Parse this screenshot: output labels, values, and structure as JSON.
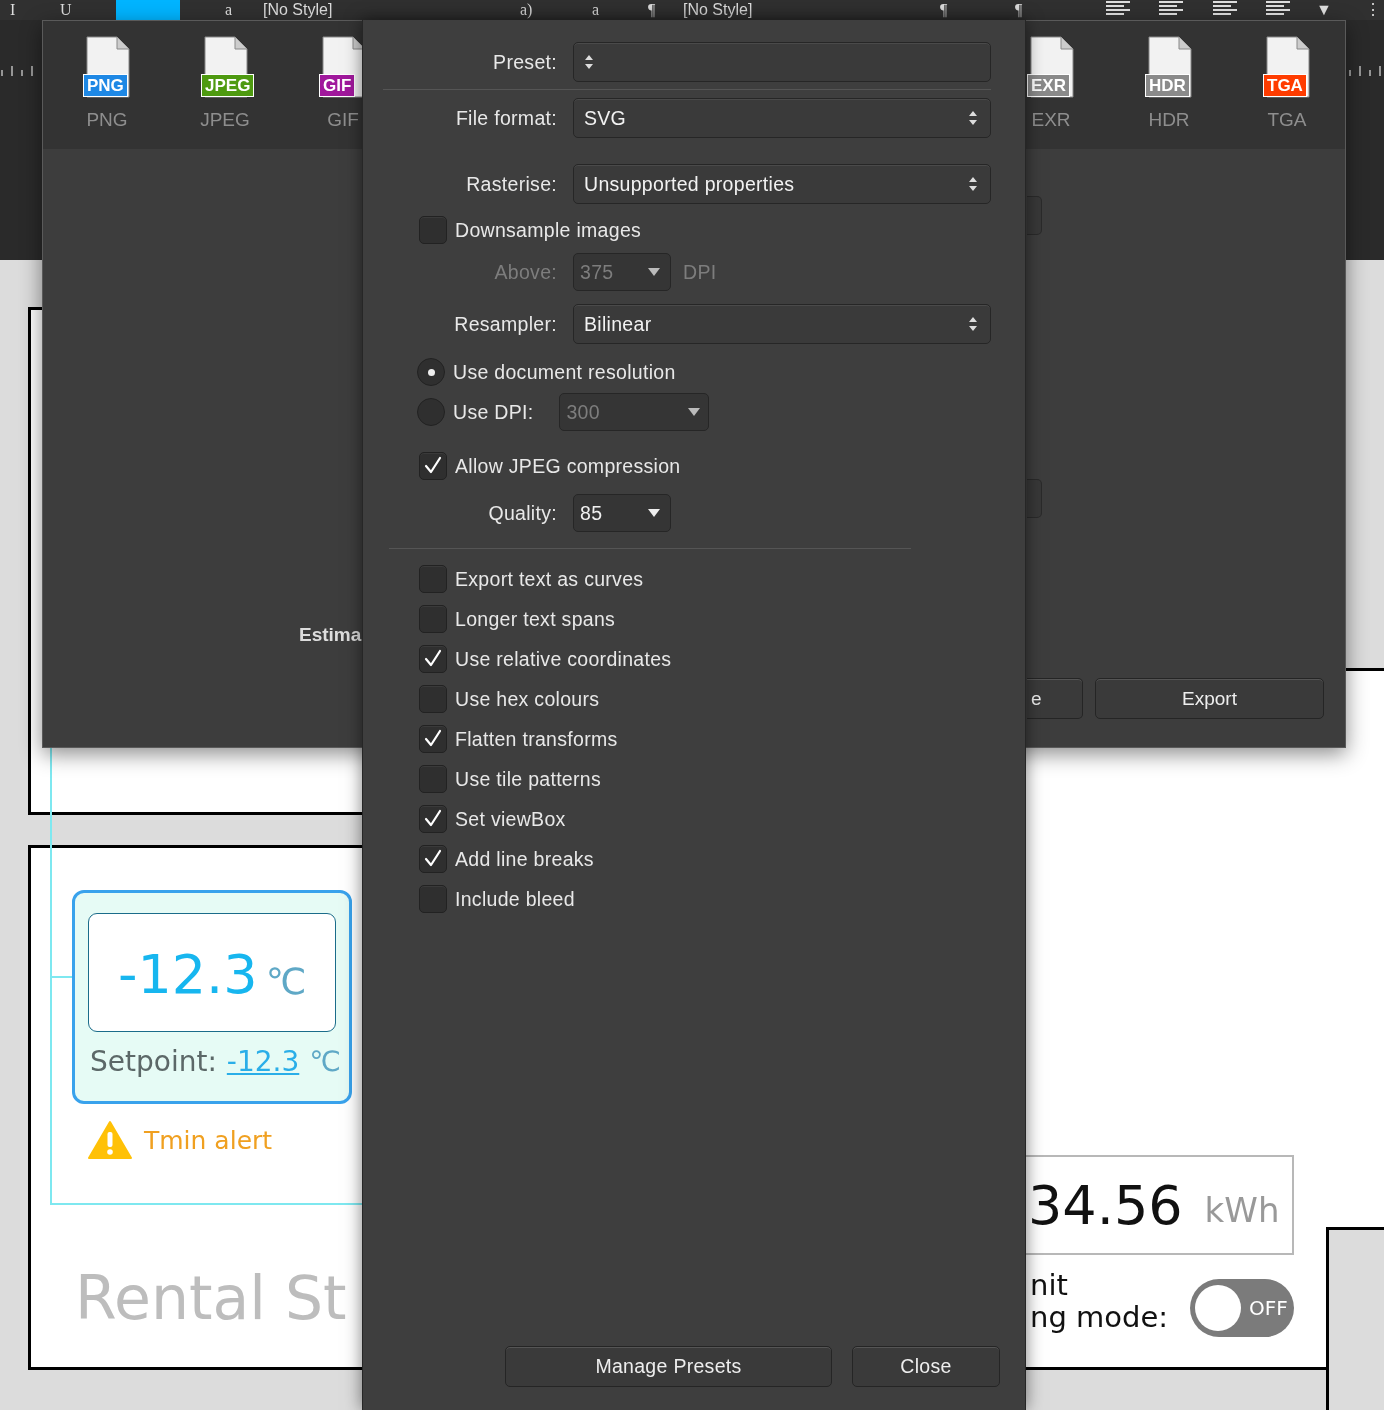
{
  "toolbar": [
    {
      "kind": "text",
      "text": "I"
    },
    {
      "kind": "text",
      "text": "U"
    },
    {
      "kind": "swatch"
    },
    {
      "kind": "text",
      "text": "a"
    },
    {
      "kind": "dropdown",
      "text": "[No Style]"
    },
    {
      "kind": "text",
      "text": "a)"
    },
    {
      "kind": "text",
      "text": "a"
    },
    {
      "kind": "text",
      "text": "¶"
    },
    {
      "kind": "dropdown",
      "text": "[No Style]"
    },
    {
      "kind": "text",
      "text": "¶"
    },
    {
      "kind": "text",
      "text": "¶"
    },
    {
      "kind": "align"
    },
    {
      "kind": "align"
    },
    {
      "kind": "align"
    },
    {
      "kind": "align"
    },
    {
      "kind": "text",
      "text": "▼"
    },
    {
      "kind": "text",
      "text": "⋮"
    }
  ],
  "canvas": {
    "artboard_titles": [
      "Rental St"
    ],
    "thermostat": {
      "reading": "-12.3",
      "unit": "℃",
      "setpoint_label": "Setpoint:",
      "setpoint_value": "-12.3",
      "setpoint_unit": "℃",
      "alert": "Tmin alert"
    },
    "energy": {
      "value": "34.56",
      "unit": "kWh"
    },
    "mode_label": [
      "nit",
      "ng mode:"
    ],
    "toggle": {
      "on": false,
      "label": "OFF"
    }
  },
  "export_window": {
    "formats": [
      {
        "badge": "PNG",
        "label": "PNG",
        "color": "#1e88e5"
      },
      {
        "badge": "JPEG",
        "label": "JPEG",
        "color": "#4e9a10"
      },
      {
        "badge": "GIF",
        "label": "GIF",
        "color": "#a0189c"
      },
      {
        "badge": "EXR",
        "label": "EXR",
        "color": "#8a8a8a"
      },
      {
        "badge": "HDR",
        "label": "HDR",
        "color": "#8a8a8a"
      },
      {
        "badge": "TGA",
        "label": "TGA",
        "color": "#ff3c00"
      }
    ],
    "estimate_label": "Estima",
    "buttons": [
      "e",
      "Export"
    ]
  },
  "dialog": {
    "rows": [
      {
        "kind": "select",
        "label": "Preset:"
      },
      {
        "kind": "divider"
      },
      {
        "kind": "select",
        "label": "File format:",
        "value": "SVG"
      },
      {
        "kind": "select",
        "label": "Rasterise:",
        "value": "Unsupported properties"
      },
      {
        "kind": "checkbox",
        "label": "Downsample images",
        "checked": false
      },
      {
        "kind": "combo",
        "label": "Above:",
        "value": "375",
        "suffix": "DPI",
        "disabled": true
      },
      {
        "kind": "select",
        "label": "Resampler:",
        "value": "Bilinear"
      },
      {
        "kind": "radio",
        "label": "Use document resolution",
        "selected": true
      },
      {
        "kind": "radio",
        "label": "Use DPI:",
        "selected": false,
        "combo": {
          "value": "300",
          "disabled": true
        }
      },
      {
        "kind": "checkbox",
        "label": "Allow JPEG compression",
        "checked": true
      },
      {
        "kind": "combo",
        "label": "Quality:",
        "value": "85",
        "disabled": false
      },
      {
        "kind": "divider"
      },
      {
        "kind": "checkbox",
        "label": "Export text as curves",
        "checked": false
      },
      {
        "kind": "checkbox",
        "label": "Longer text spans",
        "checked": false
      },
      {
        "kind": "checkbox",
        "label": "Use relative coordinates",
        "checked": true
      },
      {
        "kind": "checkbox",
        "label": "Use hex colours",
        "checked": false
      },
      {
        "kind": "checkbox",
        "label": "Flatten transforms",
        "checked": true
      },
      {
        "kind": "checkbox",
        "label": "Use tile patterns",
        "checked": false
      },
      {
        "kind": "checkbox",
        "label": "Set viewBox",
        "checked": true
      },
      {
        "kind": "checkbox",
        "label": "Add line breaks",
        "checked": true
      },
      {
        "kind": "checkbox",
        "label": "Include bleed",
        "checked": false
      }
    ],
    "buttons": [
      "Manage Presets",
      "Close"
    ]
  }
}
